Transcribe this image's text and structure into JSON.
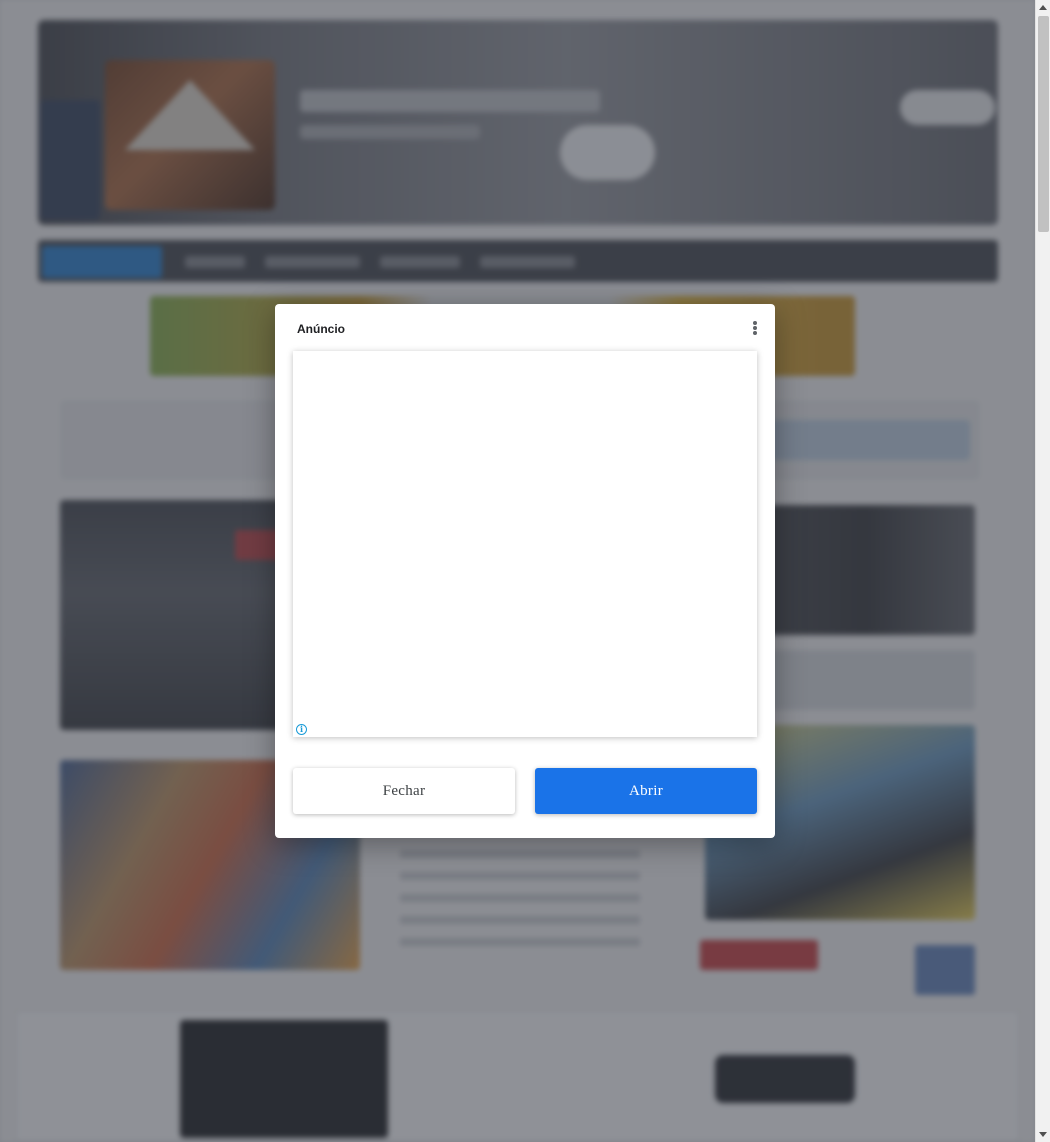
{
  "modal": {
    "title": "Anúncio",
    "menu_icon": "more-vert-icon",
    "ad_info_icon": "info-icon",
    "ad_info_symbol": "i",
    "close_label": "Fechar",
    "open_label": "Abrir"
  },
  "colors": {
    "accent": "#1a73e8",
    "info": "#1a9bd7"
  }
}
